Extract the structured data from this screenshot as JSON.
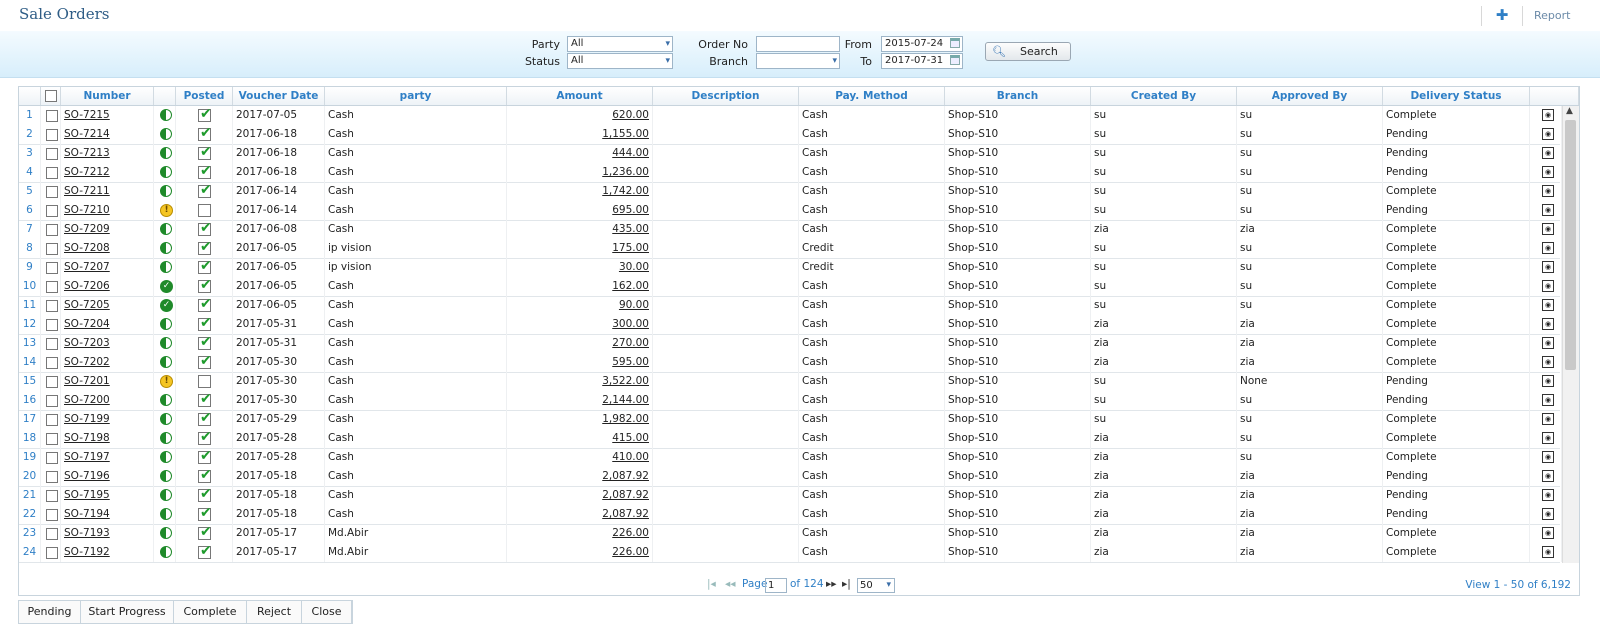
{
  "header": {
    "title": "Sale Orders",
    "add_icon": "plus-icon",
    "report_label": "Report"
  },
  "filters": {
    "party_label": "Party",
    "party_value": "All",
    "status_label": "Status",
    "status_value": "All",
    "order_no_label": "Order No",
    "order_no_value": "",
    "branch_label": "Branch",
    "branch_value": "",
    "from_label": "From",
    "from_value": "2015-07-24",
    "to_label": "To",
    "to_value": "2017-07-31",
    "search_label": "Search"
  },
  "table": {
    "columns": [
      "Number",
      "Posted",
      "Voucher Date",
      "party",
      "Amount",
      "Description",
      "Pay. Method",
      "Branch",
      "Created By",
      "Approved By",
      "Delivery Status"
    ],
    "rows": [
      {
        "n": "1",
        "number": "SO-7215",
        "status": "half",
        "posted": true,
        "date": "2017-07-05",
        "party": "Cash",
        "amount": "620.00",
        "desc": "",
        "pay": "Cash",
        "branch": "Shop-S10",
        "created": "su",
        "approved": "su",
        "delivery": "Complete"
      },
      {
        "n": "2",
        "number": "SO-7214",
        "status": "half",
        "posted": true,
        "date": "2017-06-18",
        "party": "Cash",
        "amount": "1,155.00",
        "desc": "",
        "pay": "Cash",
        "branch": "Shop-S10",
        "created": "su",
        "approved": "su",
        "delivery": "Pending"
      },
      {
        "n": "3",
        "number": "SO-7213",
        "status": "half",
        "posted": true,
        "date": "2017-06-18",
        "party": "Cash",
        "amount": "444.00",
        "desc": "",
        "pay": "Cash",
        "branch": "Shop-S10",
        "created": "su",
        "approved": "su",
        "delivery": "Pending"
      },
      {
        "n": "4",
        "number": "SO-7212",
        "status": "half",
        "posted": true,
        "date": "2017-06-18",
        "party": "Cash",
        "amount": "1,236.00",
        "desc": "",
        "pay": "Cash",
        "branch": "Shop-S10",
        "created": "su",
        "approved": "su",
        "delivery": "Pending"
      },
      {
        "n": "5",
        "number": "SO-7211",
        "status": "half",
        "posted": true,
        "date": "2017-06-14",
        "party": "Cash",
        "amount": "1,742.00",
        "desc": "",
        "pay": "Cash",
        "branch": "Shop-S10",
        "created": "su",
        "approved": "su",
        "delivery": "Complete"
      },
      {
        "n": "6",
        "number": "SO-7210",
        "status": "warn",
        "posted": false,
        "date": "2017-06-14",
        "party": "Cash",
        "amount": "695.00",
        "desc": "",
        "pay": "Cash",
        "branch": "Shop-S10",
        "created": "su",
        "approved": "su",
        "delivery": "Pending"
      },
      {
        "n": "7",
        "number": "SO-7209",
        "status": "half",
        "posted": true,
        "date": "2017-06-08",
        "party": "Cash",
        "amount": "435.00",
        "desc": "",
        "pay": "Cash",
        "branch": "Shop-S10",
        "created": "zia",
        "approved": "zia",
        "delivery": "Complete"
      },
      {
        "n": "8",
        "number": "SO-7208",
        "status": "half",
        "posted": true,
        "date": "2017-06-05",
        "party": "ip vision",
        "amount": "175.00",
        "desc": "",
        "pay": "Credit",
        "branch": "Shop-S10",
        "created": "su",
        "approved": "su",
        "delivery": "Complete"
      },
      {
        "n": "9",
        "number": "SO-7207",
        "status": "half",
        "posted": true,
        "date": "2017-06-05",
        "party": "ip vision",
        "amount": "30.00",
        "desc": "",
        "pay": "Credit",
        "branch": "Shop-S10",
        "created": "su",
        "approved": "su",
        "delivery": "Complete"
      },
      {
        "n": "10",
        "number": "SO-7206",
        "status": "done",
        "posted": true,
        "date": "2017-06-05",
        "party": "Cash",
        "amount": "162.00",
        "desc": "",
        "pay": "Cash",
        "branch": "Shop-S10",
        "created": "su",
        "approved": "su",
        "delivery": "Complete"
      },
      {
        "n": "11",
        "number": "SO-7205",
        "status": "done",
        "posted": true,
        "date": "2017-06-05",
        "party": "Cash",
        "amount": "90.00",
        "desc": "",
        "pay": "Cash",
        "branch": "Shop-S10",
        "created": "su",
        "approved": "su",
        "delivery": "Complete"
      },
      {
        "n": "12",
        "number": "SO-7204",
        "status": "half",
        "posted": true,
        "date": "2017-05-31",
        "party": "Cash",
        "amount": "300.00",
        "desc": "",
        "pay": "Cash",
        "branch": "Shop-S10",
        "created": "zia",
        "approved": "zia",
        "delivery": "Complete"
      },
      {
        "n": "13",
        "number": "SO-7203",
        "status": "half",
        "posted": true,
        "date": "2017-05-31",
        "party": "Cash",
        "amount": "270.00",
        "desc": "",
        "pay": "Cash",
        "branch": "Shop-S10",
        "created": "zia",
        "approved": "zia",
        "delivery": "Complete"
      },
      {
        "n": "14",
        "number": "SO-7202",
        "status": "half",
        "posted": true,
        "date": "2017-05-30",
        "party": "Cash",
        "amount": "595.00",
        "desc": "",
        "pay": "Cash",
        "branch": "Shop-S10",
        "created": "zia",
        "approved": "zia",
        "delivery": "Complete"
      },
      {
        "n": "15",
        "number": "SO-7201",
        "status": "warn",
        "posted": false,
        "date": "2017-05-30",
        "party": "Cash",
        "amount": "3,522.00",
        "desc": "",
        "pay": "Cash",
        "branch": "Shop-S10",
        "created": "su",
        "approved": "None",
        "delivery": "Pending"
      },
      {
        "n": "16",
        "number": "SO-7200",
        "status": "half",
        "posted": true,
        "date": "2017-05-30",
        "party": "Cash",
        "amount": "2,144.00",
        "desc": "",
        "pay": "Cash",
        "branch": "Shop-S10",
        "created": "su",
        "approved": "su",
        "delivery": "Pending"
      },
      {
        "n": "17",
        "number": "SO-7199",
        "status": "half",
        "posted": true,
        "date": "2017-05-29",
        "party": "Cash",
        "amount": "1,982.00",
        "desc": "",
        "pay": "Cash",
        "branch": "Shop-S10",
        "created": "su",
        "approved": "su",
        "delivery": "Complete"
      },
      {
        "n": "18",
        "number": "SO-7198",
        "status": "half",
        "posted": true,
        "date": "2017-05-28",
        "party": "Cash",
        "amount": "415.00",
        "desc": "",
        "pay": "Cash",
        "branch": "Shop-S10",
        "created": "zia",
        "approved": "su",
        "delivery": "Complete"
      },
      {
        "n": "19",
        "number": "SO-7197",
        "status": "half",
        "posted": true,
        "date": "2017-05-28",
        "party": "Cash",
        "amount": "410.00",
        "desc": "",
        "pay": "Cash",
        "branch": "Shop-S10",
        "created": "zia",
        "approved": "su",
        "delivery": "Complete"
      },
      {
        "n": "20",
        "number": "SO-7196",
        "status": "half",
        "posted": true,
        "date": "2017-05-18",
        "party": "Cash",
        "amount": "2,087.92",
        "desc": "",
        "pay": "Cash",
        "branch": "Shop-S10",
        "created": "zia",
        "approved": "zia",
        "delivery": "Pending"
      },
      {
        "n": "21",
        "number": "SO-7195",
        "status": "half",
        "posted": true,
        "date": "2017-05-18",
        "party": "Cash",
        "amount": "2,087.92",
        "desc": "",
        "pay": "Cash",
        "branch": "Shop-S10",
        "created": "zia",
        "approved": "zia",
        "delivery": "Pending"
      },
      {
        "n": "22",
        "number": "SO-7194",
        "status": "half",
        "posted": true,
        "date": "2017-05-18",
        "party": "Cash",
        "amount": "2,087.92",
        "desc": "",
        "pay": "Cash",
        "branch": "Shop-S10",
        "created": "zia",
        "approved": "zia",
        "delivery": "Pending"
      },
      {
        "n": "23",
        "number": "SO-7193",
        "status": "half",
        "posted": true,
        "date": "2017-05-17",
        "party": "Md.Abir",
        "amount": "226.00",
        "desc": "",
        "pay": "Cash",
        "branch": "Shop-S10",
        "created": "zia",
        "approved": "zia",
        "delivery": "Complete"
      },
      {
        "n": "24",
        "number": "SO-7192",
        "status": "half",
        "posted": true,
        "date": "2017-05-17",
        "party": "Md.Abir",
        "amount": "226.00",
        "desc": "",
        "pay": "Cash",
        "branch": "Shop-S10",
        "created": "zia",
        "approved": "zia",
        "delivery": "Complete"
      }
    ]
  },
  "pager": {
    "page_label": "Page",
    "page_value": "1",
    "of_label": "of 124",
    "page_size": "50",
    "view_info": "View 1 - 50 of 6,192"
  },
  "actions": [
    "Pending",
    "Start Progress",
    "Complete",
    "Reject",
    "Close"
  ]
}
